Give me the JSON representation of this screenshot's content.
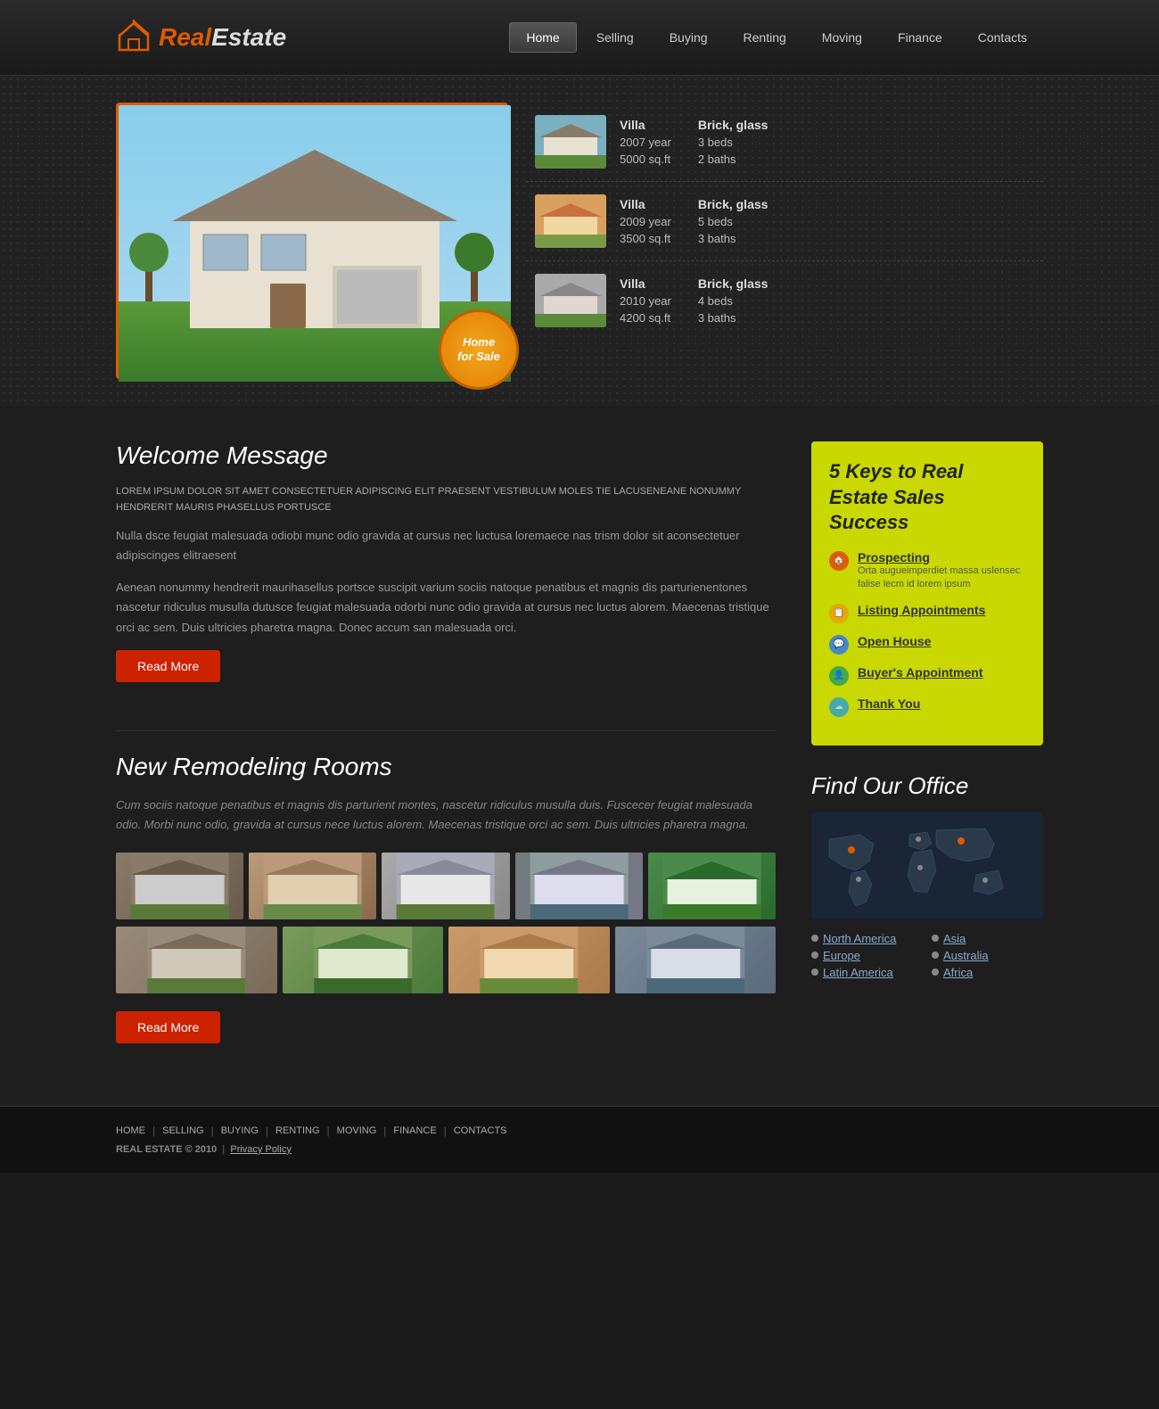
{
  "logo": {
    "icon": "🏠",
    "real": "Real",
    "estate": "Estate"
  },
  "nav": {
    "items": [
      {
        "label": "Home",
        "active": true
      },
      {
        "label": "Selling",
        "active": false
      },
      {
        "label": "Buying",
        "active": false
      },
      {
        "label": "Renting",
        "active": false
      },
      {
        "label": "Moving",
        "active": false
      },
      {
        "label": "Finance",
        "active": false
      },
      {
        "label": "Contacts",
        "active": false
      }
    ]
  },
  "hero": {
    "sale_badge_line1": "Home",
    "sale_badge_line2": "for Sale"
  },
  "properties": [
    {
      "type": "Villa",
      "year": "2007 year",
      "sqft": "5000 sq.ft",
      "material": "Brick, glass",
      "beds": "3 beds",
      "baths": "2 baths",
      "thumb_class": "thumb-1"
    },
    {
      "type": "Villa",
      "year": "2009 year",
      "sqft": "3500 sq.ft",
      "material": "Brick, glass",
      "beds": "5 beds",
      "baths": "3 baths",
      "thumb_class": "thumb-2"
    },
    {
      "type": "Villa",
      "year": "2010 year",
      "sqft": "4200 sq.ft",
      "material": "Brick, glass",
      "beds": "4 beds",
      "baths": "3 baths",
      "thumb_class": "thumb-3"
    }
  ],
  "welcome": {
    "title": "Welcome Message",
    "text_upper": "LOREM IPSUM DOLOR SIT AMET CONSECTETUER ADIPISCING ELIT PRAESENT VESTIBULUM MOLES TIE LACUSENEANE NONUMMY HENDRERIT MAURIS PHASELLUS PORTUSCE",
    "text_normal": "Nulla dsce feugiat malesuada odiobi munc odio gravida at cursus nec luctusa loremaece nas trism dolor sit aconsectetuer adipiscinges elitraesent",
    "text_long": "Aenean nonummy hendrerit maurihasellus portsce suscipit varium sociis natoque penatibus et magnis dis parturienentones nascetur ridiculus musulla dutusce feugiat malesuada odorbi nunc odio gravida at cursus nec luctus alorem. Maecenas tristique orci ac sem. Duis ultricies pharetra magna. Donec accum san malesuada orci.",
    "read_more": "Read More"
  },
  "remodeling": {
    "title": "New Remodeling Rooms",
    "text_italic": "Cum sociis natoque penatibus et magnis dis parturient montes, nascetur ridiculus musulla duis. Fuscecer feugiat malesuada odio. Morbi nunc odio, gravida at cursus nece luctus alorem. Maecenas tristique orci ac sem. Duis ultricies pharetra magna.",
    "read_more": "Read More"
  },
  "keys": {
    "title": "5 Keys to Real Estate Sales Success",
    "items": [
      {
        "label": "Prospecting",
        "desc": "Orta augueimperdiet massa uslensec falise lecm id lorem ipsum",
        "color_class": "ki-orange"
      },
      {
        "label": "Listing Appointments",
        "desc": "",
        "color_class": "ki-yellow"
      },
      {
        "label": "Open House",
        "desc": "",
        "color_class": "ki-blue"
      },
      {
        "label": "Buyer's Appointment",
        "desc": "",
        "color_class": "ki-green"
      },
      {
        "label": "Thank You",
        "desc": "",
        "color_class": "ki-teal"
      }
    ]
  },
  "office": {
    "title": "Find Our Office",
    "locations": [
      {
        "name": "North America",
        "col": 1
      },
      {
        "name": "Asia",
        "col": 2
      },
      {
        "name": "Europe",
        "col": 1
      },
      {
        "name": "Australia",
        "col": 2
      },
      {
        "name": "Latin America",
        "col": 1
      },
      {
        "name": "Africa",
        "col": 2
      }
    ]
  },
  "footer": {
    "nav_items": [
      "HOME",
      "SELLING",
      "BUYING",
      "RENTING",
      "MOVING",
      "FINANCE",
      "CONTACTS"
    ],
    "brand": "REAL ESTATE",
    "year": "© 2010",
    "privacy": "Privacy Policy"
  }
}
